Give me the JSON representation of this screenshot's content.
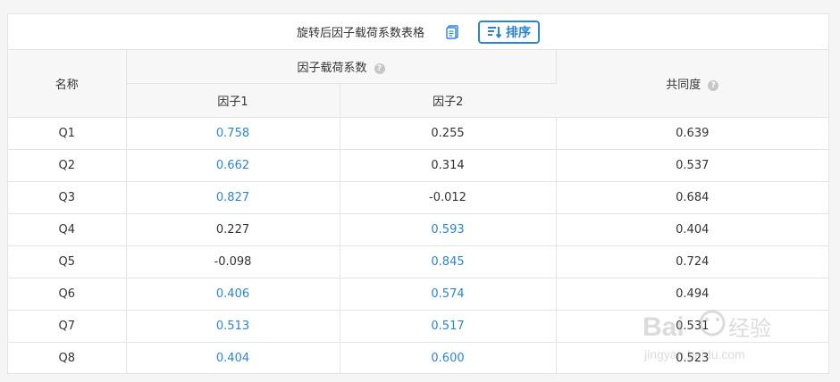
{
  "toolbar": {
    "title": "旋转后因子载荷系数表格",
    "copy_icon": "copy-icon",
    "sort_label": "排序",
    "sort_icon": "sort-lines-icon",
    "accent_color": "#2b85d4"
  },
  "table": {
    "headers": {
      "name": "名称",
      "loading_group": "因子载荷系数",
      "factor1": "因子1",
      "factor2": "因子2",
      "communality": "共同度",
      "help_glyph": "?"
    },
    "rows": [
      {
        "name": "Q1",
        "f1": "0.758",
        "f2": "0.255",
        "comm": "0.639",
        "f1_highlight": true,
        "f2_highlight": false
      },
      {
        "name": "Q2",
        "f1": "0.662",
        "f2": "0.314",
        "comm": "0.537",
        "f1_highlight": true,
        "f2_highlight": false
      },
      {
        "name": "Q3",
        "f1": "0.827",
        "f2": "-0.012",
        "comm": "0.684",
        "f1_highlight": true,
        "f2_highlight": false
      },
      {
        "name": "Q4",
        "f1": "0.227",
        "f2": "0.593",
        "comm": "0.404",
        "f1_highlight": false,
        "f2_highlight": true
      },
      {
        "name": "Q5",
        "f1": "-0.098",
        "f2": "0.845",
        "comm": "0.724",
        "f1_highlight": false,
        "f2_highlight": true
      },
      {
        "name": "Q6",
        "f1": "0.406",
        "f2": "0.574",
        "comm": "0.494",
        "f1_highlight": true,
        "f2_highlight": true
      },
      {
        "name": "Q7",
        "f1": "0.513",
        "f2": "0.517",
        "comm": "0.531",
        "f1_highlight": true,
        "f2_highlight": true
      },
      {
        "name": "Q8",
        "f1": "0.404",
        "f2": "0.600",
        "comm": "0.523",
        "f1_highlight": true,
        "f2_highlight": true
      }
    ]
  },
  "watermark": {
    "brand": "Bai",
    "brand_suffix": "经验",
    "url": "jingyan.baidu.com"
  }
}
